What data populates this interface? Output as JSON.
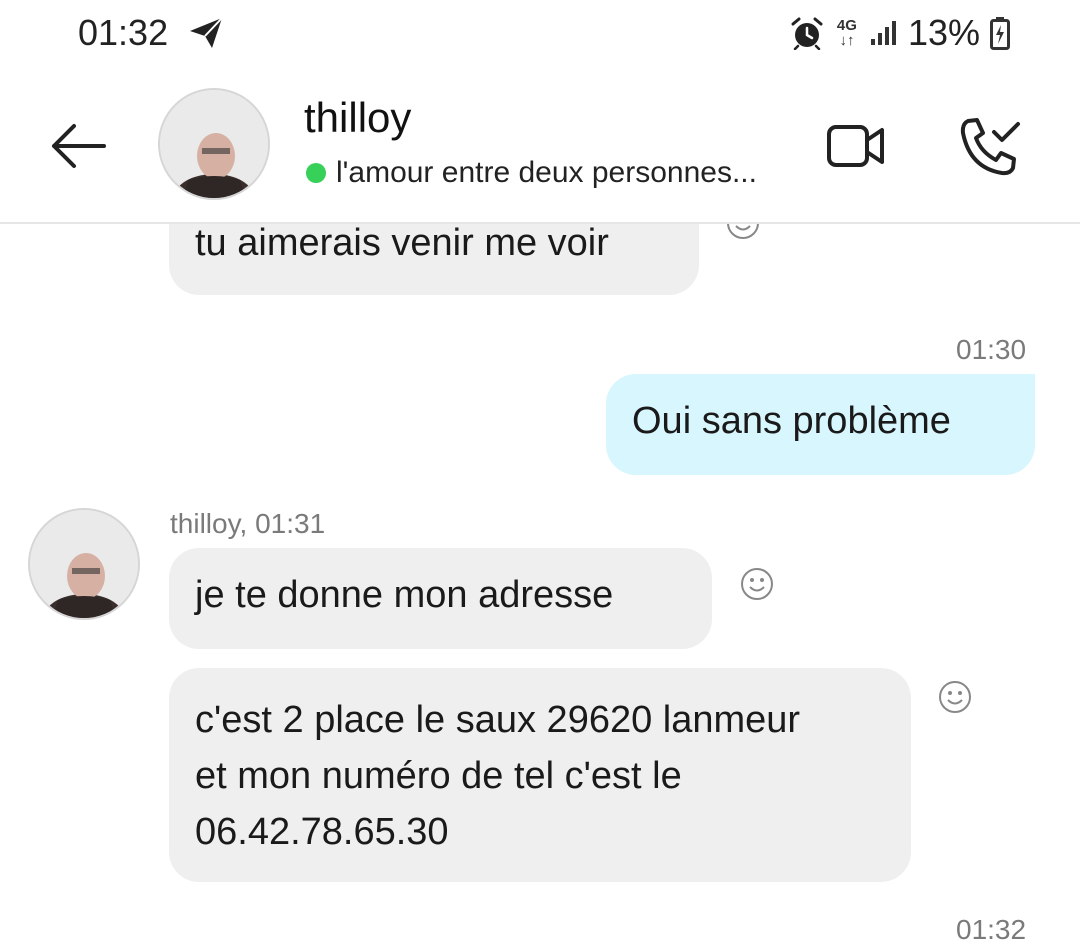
{
  "status_bar": {
    "time": "01:32",
    "network": "4G",
    "battery": "13%"
  },
  "header": {
    "contact_name": "thilloy",
    "status_text": "l'amour entre deux personnes...",
    "online_color": "#37d058"
  },
  "messages": {
    "partial_message": "tu aimerais venir me voir",
    "sent_time": "01:30",
    "sent_text": "Oui sans problème",
    "received_sender": "thilloy, 01:31",
    "received_1": "je te donne mon adresse",
    "received_2_line1": "c'est 2 place le saux 29620 lanmeur",
    "received_2_line2": "et mon numéro de tel c'est le",
    "received_2_line3": "06.42.78.65.30",
    "last_time": "01:32"
  },
  "colors": {
    "sent_bubble": "#d7f6fd",
    "received_bubble": "#efefef"
  },
  "icons": [
    "send-icon",
    "alarm-icon",
    "signal-icon",
    "battery-icon",
    "back-arrow-icon",
    "video-call-icon",
    "phone-call-icon",
    "smiley-react-icon"
  ]
}
